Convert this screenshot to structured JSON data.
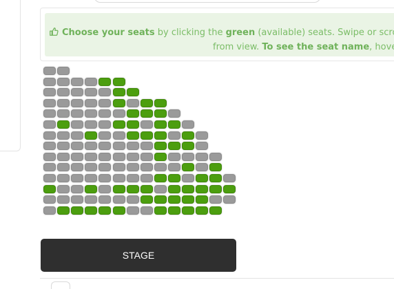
{
  "info": {
    "line1_bold_a": "Choose your seats",
    "line1_text_a": " by clicking the ",
    "line1_bold_b": "green",
    "line1_text_b": " (available) seats. Swipe or scro",
    "line2_text_a": "from view. ",
    "line2_bold_a": "To see the seat name",
    "line2_text_b": ", hover o",
    "icon": "thumbs-up-icon",
    "colors": {
      "background": "#eaf4e5",
      "text": "#7bbd67"
    }
  },
  "stage": {
    "label": "STAGE"
  },
  "seat_colors": {
    "available": "#4c9e0f",
    "unavailable": "#9a9a9a"
  },
  "seat_rows": [
    "UU",
    "UUUUAA",
    "UUUUUAA",
    "UUUUUAUAA",
    "UUUUUUAAAU",
    "UAUUUAAUAAU",
    "UUUAUUAAAUAU",
    "UUUUUUUUAAAU",
    "UUUUUUUUAUUUU",
    "UUUUUUUUUUAUA",
    "UUUUUUUUAAUAAU",
    "AUUAUAAAUAAAAA",
    "UUUUUUUAAAAAUU",
    "UAAAAAUUAAAAA"
  ]
}
